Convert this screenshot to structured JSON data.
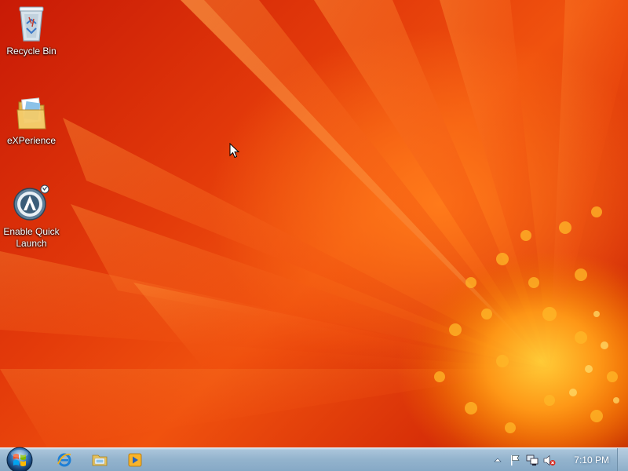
{
  "desktop": {
    "icons": [
      {
        "label": "Recycle Bin",
        "icon": "recycle-bin-icon"
      },
      {
        "label": "eXPerience",
        "icon": "folder-icon"
      },
      {
        "label": "Enable Quick\nLaunch",
        "icon": "autoit-script-icon"
      }
    ],
    "wallpaper": "orange-gerbera-flower"
  },
  "taskbar": {
    "start_icon": "windows-orb-icon",
    "pinned": [
      {
        "name": "internet-explorer",
        "icon": "internet-explorer-icon"
      },
      {
        "name": "windows-explorer",
        "icon": "windows-explorer-icon"
      },
      {
        "name": "media-player",
        "icon": "media-player-icon"
      }
    ],
    "tray": {
      "icons": [
        "show-hidden-icons-icon",
        "action-center-flag-icon",
        "network-icon",
        "volume-muted-icon"
      ],
      "clock": "7:10 PM"
    }
  },
  "colors": {
    "taskbar_top": "#cfe0ee",
    "taskbar_bottom": "#86a9c6",
    "wallpaper_base": "#e33a0a"
  }
}
